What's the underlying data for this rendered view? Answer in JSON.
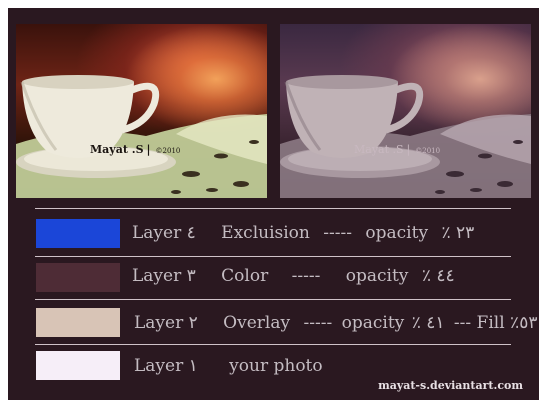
{
  "photos": {
    "left": {
      "credit": "Mayat .S",
      "separator": "|",
      "year": "©2010"
    },
    "right": {
      "credit": "Mayat .S",
      "separator": "|",
      "year": "©2010"
    }
  },
  "layers": [
    {
      "swatch_color": "#1b46d8",
      "name": "Layer ٤",
      "blend": "Excluision",
      "sep": "-----",
      "opacity_label": "opacity",
      "opacity_value": "٪ ٢٣",
      "extra": ""
    },
    {
      "swatch_color": "#4e2c36",
      "name": "Layer ٣",
      "blend": "Color",
      "sep": "-----",
      "opacity_label": "opacity",
      "opacity_value": "٪ ٤٤",
      "extra": ""
    },
    {
      "swatch_color": "#d8c4b6",
      "name": "Layer ٢",
      "blend": "Overlay",
      "sep": "-----",
      "opacity_label": "opacity",
      "opacity_value": "٪ ٤١",
      "extra": "--- Fill ٪٥٣"
    },
    {
      "swatch_color": "#f6eef8",
      "name": "Layer ١",
      "blend": "your photo",
      "sep": "",
      "opacity_label": "",
      "opacity_value": "",
      "extra": ""
    }
  ],
  "footer": {
    "text": "mayat-s.deviantart.com"
  }
}
